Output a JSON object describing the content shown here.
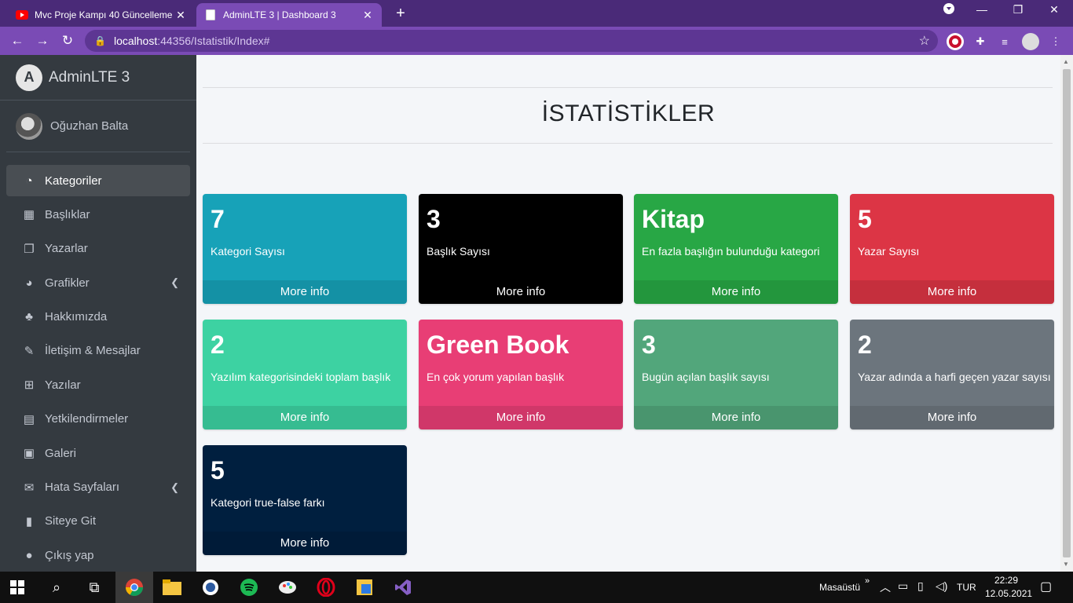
{
  "browser": {
    "tabs": [
      {
        "title": "Mvc Proje Kampı 40 Güncelleme"
      },
      {
        "title": "AdminLTE 3 | Dashboard 3"
      }
    ],
    "url_host": "localhost",
    "url_path": ":44356/Istatistik/Index#"
  },
  "sidebar": {
    "brand": "AdminLTE 3",
    "user": "Oğuzhan Balta",
    "items": [
      {
        "label": "Kategoriler"
      },
      {
        "label": "Başlıklar"
      },
      {
        "label": "Yazarlar"
      },
      {
        "label": "Grafikler"
      },
      {
        "label": "Hakkımızda"
      },
      {
        "label": "İletişim & Mesajlar"
      },
      {
        "label": "Yazılar"
      },
      {
        "label": "Yetkilendirmeler"
      },
      {
        "label": "Galeri"
      },
      {
        "label": "Hata Sayfaları"
      },
      {
        "label": "Siteye Git"
      },
      {
        "label": "Çıkış yap"
      }
    ]
  },
  "main": {
    "title": "İSTATİSTİKLER",
    "boxes": [
      {
        "value": "7",
        "label": "Kategori Sayısı",
        "footer": "More info",
        "color": "#17a2b8"
      },
      {
        "value": "3",
        "label": "Başlık Sayısı",
        "footer": "More info",
        "color": "#000000"
      },
      {
        "value": "Kitap",
        "label": "En fazla başlığın bulunduğu kategori",
        "footer": "More info",
        "color": "#28a745"
      },
      {
        "value": "5",
        "label": "Yazar Sayısı",
        "footer": "More info",
        "color": "#dc3545"
      },
      {
        "value": "2",
        "label": "Yazılım kategorisindeki toplam başlık",
        "footer": "More info",
        "color": "#3dd2a2"
      },
      {
        "value": "Green Book",
        "label": "En çok yorum yapılan başlık",
        "footer": "More info",
        "color": "#e83e75"
      },
      {
        "value": "3",
        "label": "Bugün açılan başlık sayısı",
        "footer": "More info",
        "color": "#52a67b"
      },
      {
        "value": "2",
        "label": "Yazar adında a harfi geçen yazar sayısı",
        "footer": "More info",
        "color": "#6c757d"
      },
      {
        "value": "5",
        "label": "Kategori true-false farkı",
        "footer": "More info",
        "color": "#001f3f"
      }
    ]
  },
  "taskbar": {
    "desktop_label": "Masaüstü",
    "lang": "TUR",
    "time": "22:29",
    "date": "12.05.2021"
  }
}
